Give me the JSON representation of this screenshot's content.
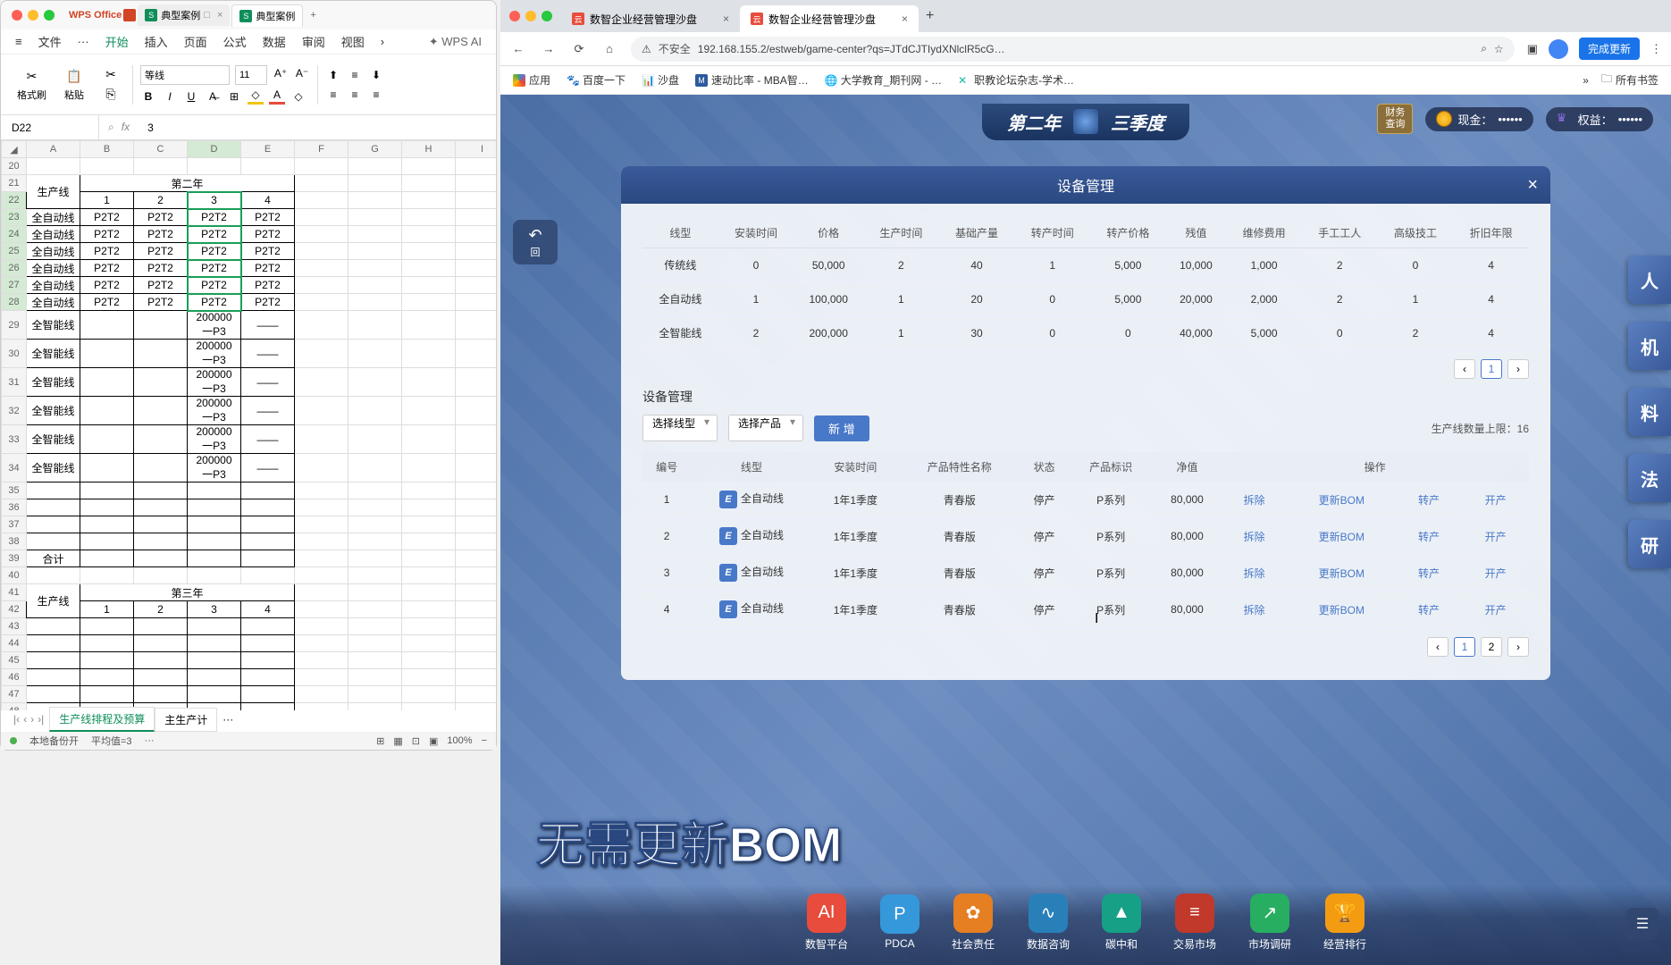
{
  "wps": {
    "app_name": "WPS Office",
    "tabs": [
      {
        "icon": "S",
        "label": "典型案例",
        "active": false,
        "closable": true
      },
      {
        "icon": "S",
        "label": "典型案例",
        "active": true
      }
    ],
    "menu": {
      "file": "文件",
      "items": [
        "开始",
        "插入",
        "页面",
        "公式",
        "数据",
        "审阅",
        "视图"
      ],
      "active_idx": 0,
      "ai": "WPS AI"
    },
    "toolbar": {
      "format_paint": "格式刷",
      "paste": "粘贴",
      "font": "等线",
      "font_size": "11"
    },
    "cell_ref": "D22",
    "formula_val": "3",
    "cols": [
      "A",
      "B",
      "C",
      "D",
      "E",
      "F",
      "G",
      "H",
      "I"
    ],
    "row_start": 20,
    "year2_header": "第二年",
    "prod_line_hdr": "生产线",
    "quarters": [
      "1",
      "2",
      "3",
      "4"
    ],
    "auto_rows": [
      {
        "name": "全自动线",
        "q": [
          "P2T2",
          "P2T2",
          "P2T2",
          "P2T2"
        ]
      },
      {
        "name": "全自动线",
        "q": [
          "P2T2",
          "P2T2",
          "P2T2",
          "P2T2"
        ]
      },
      {
        "name": "全自动线",
        "q": [
          "P2T2",
          "P2T2",
          "P2T2",
          "P2T2"
        ]
      },
      {
        "name": "全自动线",
        "q": [
          "P2T2",
          "P2T2",
          "P2T2",
          "P2T2"
        ]
      },
      {
        "name": "全自动线",
        "q": [
          "P2T2",
          "P2T2",
          "P2T2",
          "P2T2"
        ]
      },
      {
        "name": "全自动线",
        "q": [
          "P2T2",
          "P2T2",
          "P2T2",
          "P2T2"
        ]
      }
    ],
    "smart_rows": [
      {
        "name": "全智能线",
        "q3": "200000一P3",
        "q4": "——"
      },
      {
        "name": "全智能线",
        "q3": "200000一P3",
        "q4": "——"
      },
      {
        "name": "全智能线",
        "q3": "200000一P3",
        "q4": "——"
      },
      {
        "name": "全智能线",
        "q3": "200000一P3",
        "q4": "——"
      },
      {
        "name": "全智能线",
        "q3": "200000一P3",
        "q4": "——"
      },
      {
        "name": "全智能线",
        "q3": "200000一P3",
        "q4": "——"
      }
    ],
    "total_label": "合计",
    "year3_header": "第三年",
    "sheet_tabs": [
      "生产线排程及预算",
      "主生产计"
    ],
    "active_sheet": 0,
    "status": {
      "backup": "本地备份开",
      "avg": "平均值=3",
      "dots": "···",
      "view_icons": 4,
      "zoom": "100%"
    }
  },
  "chrome": {
    "tabs": [
      {
        "title": "数智企业经营管理沙盘",
        "active": false
      },
      {
        "title": "数智企业经营管理沙盘",
        "active": true
      }
    ],
    "nav": {
      "insecure": "不安全",
      "url": "192.168.155.2/estweb/game-center?qs=JTdCJTIydXNlclR5cG…",
      "update": "完成更新"
    },
    "bookmarks": {
      "apps": "应用",
      "items": [
        "百度一下",
        "沙盘",
        "速动比率 - MBA智…",
        "大学教育_期刊网 - …",
        "职教论坛杂志-学术…"
      ],
      "all": "所有书签"
    }
  },
  "game": {
    "year": "第二年",
    "quarter": "三季度",
    "finance_btn": {
      "l1": "财务",
      "l2": "查询"
    },
    "cash_label": "现金：",
    "cash_val": "••••••",
    "equity_label": "权益：",
    "equity_val": "••••••",
    "back": "回",
    "modal_title": "设备管理",
    "info_headers": [
      "线型",
      "安装时间",
      "价格",
      "生产时间",
      "基础产量",
      "转产时间",
      "转产价格",
      "残值",
      "维修费用",
      "手工工人",
      "高级技工",
      "折旧年限"
    ],
    "info_rows": [
      {
        "name": "传统线",
        "install": "0",
        "price": "50,000",
        "prod_time": "2",
        "base_qty": "40",
        "conv_time": "1",
        "conv_price": "5,000",
        "residual": "10,000",
        "maint": "1,000",
        "workers": "2",
        "experts": "0",
        "dep_years": "4"
      },
      {
        "name": "全自动线",
        "install": "1",
        "price": "100,000",
        "prod_time": "1",
        "base_qty": "20",
        "conv_time": "0",
        "conv_price": "5,000",
        "residual": "20,000",
        "maint": "2,000",
        "workers": "2",
        "experts": "1",
        "dep_years": "4"
      },
      {
        "name": "全智能线",
        "install": "2",
        "price": "200,000",
        "prod_time": "1",
        "base_qty": "30",
        "conv_time": "0",
        "conv_price": "0",
        "residual": "40,000",
        "maint": "5,000",
        "workers": "0",
        "experts": "2",
        "dep_years": "4"
      }
    ],
    "sub_title": "设备管理",
    "sel_line": "选择线型",
    "sel_prod": "选择产品",
    "add_btn": "新 增",
    "limit_label": "生产线数量上限：",
    "limit_val": "16",
    "mgmt_headers": [
      "编号",
      "线型",
      "安装时间",
      "产品特性名称",
      "状态",
      "产品标识",
      "净值",
      "操作"
    ],
    "mgmt_rows": [
      {
        "id": "1",
        "type": "全自动线",
        "install": "1年1季度",
        "prod": "青春版",
        "status": "停产",
        "mark": "P系列",
        "net": "80,000"
      },
      {
        "id": "2",
        "type": "全自动线",
        "install": "1年1季度",
        "prod": "青春版",
        "status": "停产",
        "mark": "P系列",
        "net": "80,000"
      },
      {
        "id": "3",
        "type": "全自动线",
        "install": "1年1季度",
        "prod": "青春版",
        "status": "停产",
        "mark": "P系列",
        "net": "80,000"
      },
      {
        "id": "4",
        "type": "全自动线",
        "install": "1年1季度",
        "prod": "青春版",
        "status": "停产",
        "mark": "P系列",
        "net": "80,000"
      }
    ],
    "actions": {
      "remove": "拆除",
      "bom": "更新BOM",
      "convert": "转产",
      "start": "开产"
    },
    "side_tabs": [
      "人",
      "机",
      "料",
      "法",
      "研"
    ],
    "subtitle": "无需更新BOM",
    "nav_items": [
      {
        "label": "数智平台",
        "color": "#e74c3c",
        "sym": "AI"
      },
      {
        "label": "PDCA",
        "color": "#3498db",
        "sym": "P"
      },
      {
        "label": "社会责任",
        "color": "#e67e22",
        "sym": "✿"
      },
      {
        "label": "数据咨询",
        "color": "#2980b9",
        "sym": "∿"
      },
      {
        "label": "碳中和",
        "color": "#16a085",
        "sym": "▲"
      },
      {
        "label": "交易市场",
        "color": "#c0392b",
        "sym": "≡"
      },
      {
        "label": "市场调研",
        "color": "#27ae60",
        "sym": "↗"
      },
      {
        "label": "经营排行",
        "color": "#f39c12",
        "sym": "🏆"
      }
    ]
  }
}
